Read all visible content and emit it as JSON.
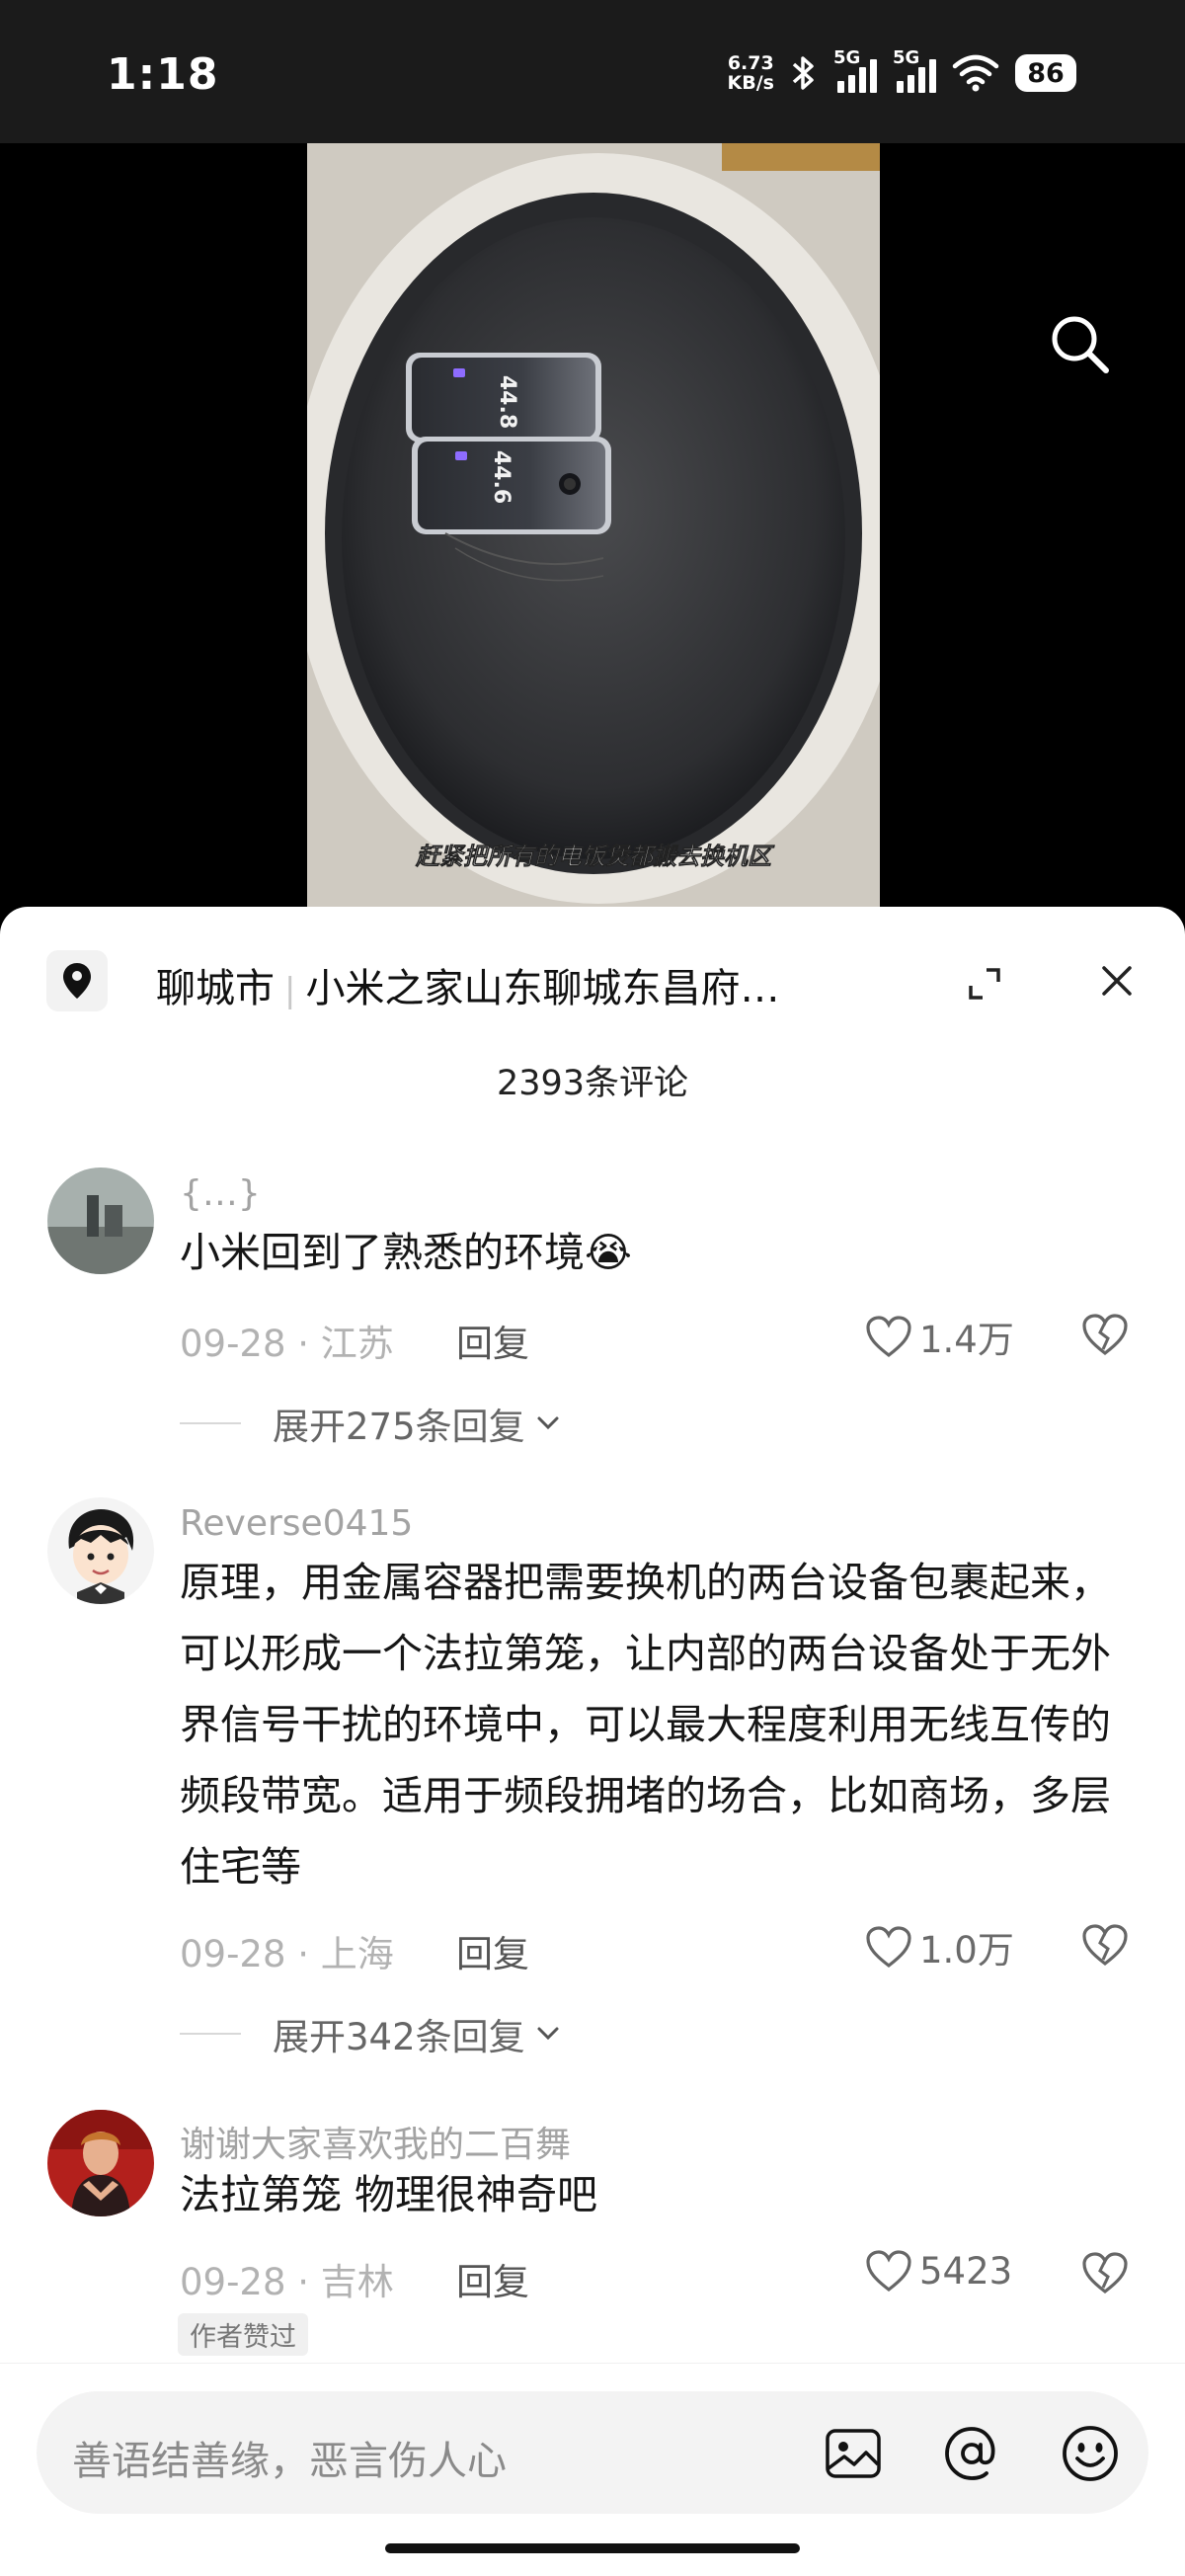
{
  "status_bar": {
    "time": "1:18",
    "net_speed_value": "6.73",
    "net_speed_unit": "KB/s",
    "sim1_label": "5G",
    "sim2_label": "5G",
    "battery": "86"
  },
  "video": {
    "phone1_reading": "44.8",
    "phone2_reading": "44.6",
    "caption": "赶紧把所有的电饭煲都搬去换机区"
  },
  "sheet": {
    "location_city": "聊城市",
    "location_store": "小米之家山东聊城东昌府…",
    "comment_count": "2393条评论"
  },
  "comments": [
    {
      "username": "{…}",
      "text": "小米回到了熟悉的环境😭",
      "date_region": "09-28 · 江苏",
      "reply_label": "回复",
      "likes": "1.4万",
      "expand_label": "展开275条回复"
    },
    {
      "username": "Reverse0415",
      "text": "原理，用金属容器把需要换机的两台设备包裹起来，可以形成一个法拉第笼，让内部的两台设备处于无外界信号干扰的环境中，可以最大程度利用无线互传的频段带宽。适用于频段拥堵的场合，比如商场，多层住宅等",
      "date_region": "09-28 · 上海",
      "reply_label": "回复",
      "likes": "1.0万",
      "expand_label": "展开342条回复"
    },
    {
      "username": "谢谢大家喜欢我的二百舞",
      "text": "法拉第笼 物理很神奇吧",
      "date_region": "09-28 · 吉林",
      "reply_label": "回复",
      "likes": "5423",
      "badge": "作者赞过"
    }
  ],
  "input": {
    "placeholder": "善语结善缘，恶言伤人心"
  },
  "icons": {
    "search": "search-icon",
    "location": "location-pin-icon",
    "expand": "expand-icon",
    "close": "close-icon",
    "like": "heart-icon",
    "dislike": "broken-heart-icon",
    "image": "image-icon",
    "mention": "at-icon",
    "emoji": "emoji-icon"
  }
}
